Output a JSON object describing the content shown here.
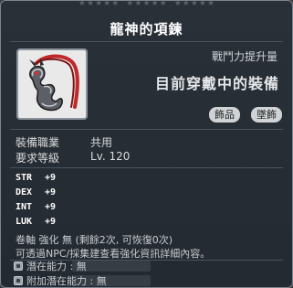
{
  "item": {
    "name": "龍神的項鍊",
    "power_label": "戰鬥力提升量",
    "equipped_text": "目前穿戴中的裝備",
    "tags": [
      "飾品",
      "墜飾"
    ],
    "icon": "dragon-pendant-icon"
  },
  "requirements": {
    "job_label": "裝備職業",
    "job_value": "共用",
    "level_label": "要求等級",
    "level_value": "Lv. 120"
  },
  "stats": [
    {
      "name": "STR",
      "value": "+9"
    },
    {
      "name": "DEX",
      "value": "+9"
    },
    {
      "name": "INT",
      "value": "+9"
    },
    {
      "name": "LUK",
      "value": "+9"
    }
  ],
  "notes": {
    "scroll": "卷軸 強化 無 (剩餘2次, 可恢復0次)",
    "npc": "可透過NPC/採集建查看強化資訊詳細內容。"
  },
  "potential": {
    "main_label": "潛在能力 : 無",
    "extra_label": "附加潛在能力 : 無"
  },
  "colors": {
    "panel_bg": "#262c33",
    "title": "#ffffff",
    "text": "#d8dadc",
    "tag_bg": "#cfd3d6",
    "icon_red": "#c0282a"
  }
}
